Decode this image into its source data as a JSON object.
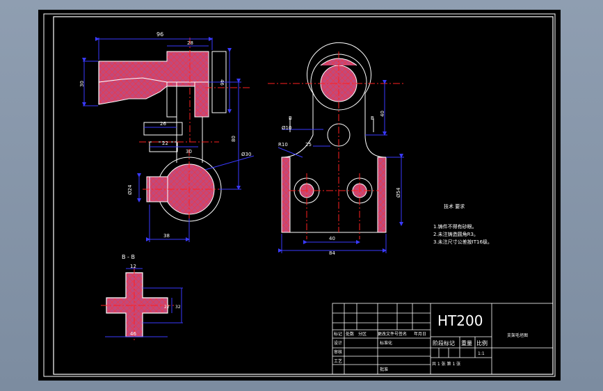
{
  "colors": {
    "background": "#000000",
    "outline": "#ffffff",
    "dimension": "#3a3aff",
    "centerline": "#ff2020",
    "hatch_fill": "#c2497a",
    "hatch_line": "#ff3030",
    "section_tint": "#d080ff"
  },
  "front_view": {
    "dim_top": "96",
    "dim_top_inner": "28",
    "dim_left": "30",
    "dim_right": "46",
    "dim_mid": "80",
    "dim_boss_a": "26",
    "dim_boss_b": "22",
    "dim_stem": "30",
    "dim_dia": "Ø30",
    "dim_bore": "Ø24",
    "dim_bottom": "38"
  },
  "side_view": {
    "label_b_left": "B",
    "label_b_right": "B",
    "dim_dia10": "Ø10",
    "dim_r10": "R10",
    "dim_neck": "25",
    "dim_height": "40",
    "dim_width": "Ø54",
    "dim_holes": "40",
    "dim_base": "84"
  },
  "section_bb": {
    "title": "B - B",
    "dim_top": "12",
    "dim_right_a": "22",
    "dim_right_b": "32",
    "dim_bottom": "46"
  },
  "tech_notes": {
    "title": "技术 要求",
    "items": [
      "1.铸件不得有砂眼。",
      "2.未注铸造圆角R3。",
      "3.未注尺寸公差按IT16级。"
    ]
  },
  "title_block": {
    "material": "HT200",
    "drawing_name": "支架毛坯图",
    "row_labels": [
      "标记",
      "处数",
      "分区",
      "更改文件号",
      "签名",
      "年月日"
    ],
    "designer_label": "设计",
    "standard_label": "标准化",
    "review_label": "审核",
    "process_label": "工艺",
    "approve_label": "批准",
    "stage_label": "阶段标记",
    "weight_label": "重量",
    "scale_label": "比例",
    "scale_value": "1:1",
    "sheet_text": "共  1  张    第  1  张"
  }
}
